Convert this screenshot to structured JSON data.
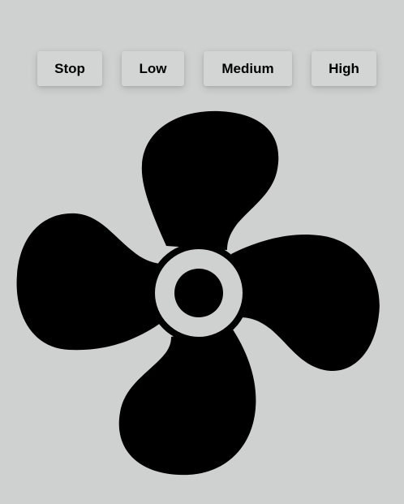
{
  "controls": {
    "stop_label": "Stop",
    "low_label": "Low",
    "medium_label": "Medium",
    "high_label": "High"
  },
  "fan": {
    "icon": "fan-icon",
    "color": "#000000",
    "hub_ring_color": "#cfd1d0",
    "background": "#cfd1d0"
  }
}
